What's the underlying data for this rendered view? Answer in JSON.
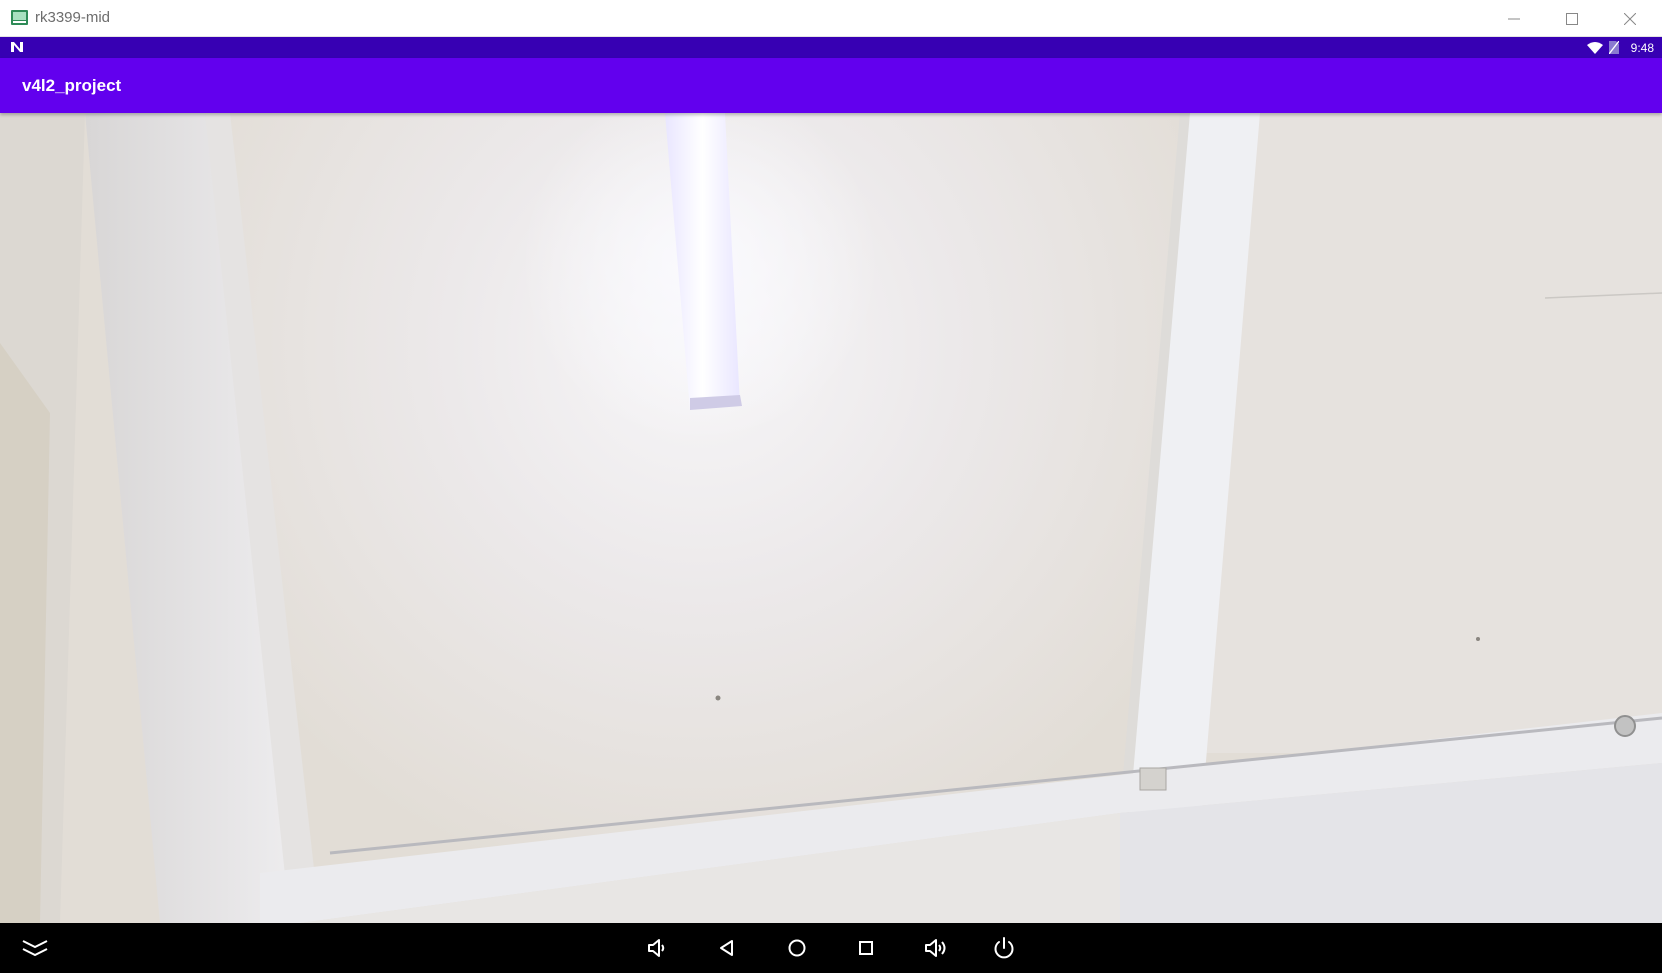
{
  "window": {
    "title": "rk3399-mid",
    "controls": {
      "minimize_icon": "minimize-icon",
      "maximize_icon": "maximize-icon",
      "close_icon": "close-icon"
    }
  },
  "status_bar": {
    "time": "9:48",
    "background": "#3700b3",
    "icons": [
      "notification-n-icon",
      "wifi-icon",
      "no-sim-icon"
    ]
  },
  "app_bar": {
    "title": "v4l2_project",
    "background": "#6200ee"
  },
  "preview": {
    "content": "camera-preview"
  },
  "nav_bar": {
    "background": "#000000",
    "buttons": [
      "collapse-icon",
      "volume-down-icon",
      "back-icon",
      "home-icon",
      "recents-icon",
      "volume-up-icon",
      "power-icon"
    ]
  }
}
